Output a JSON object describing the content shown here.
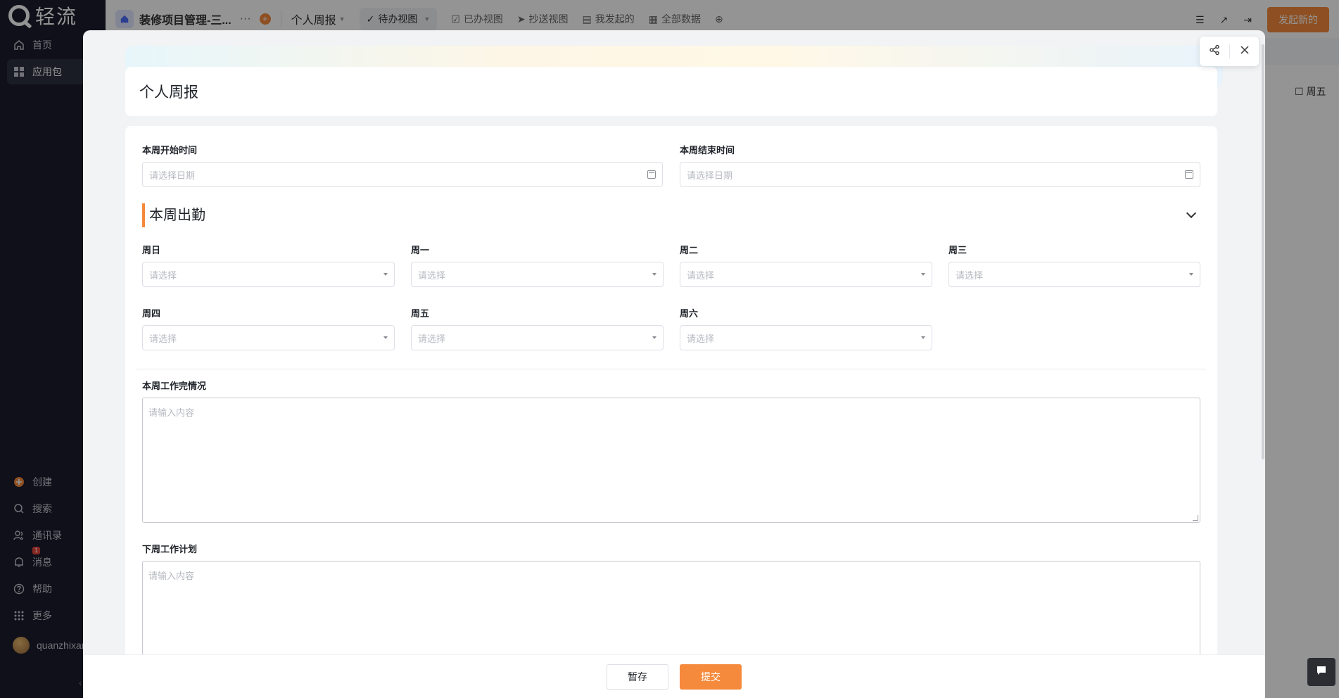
{
  "sidebar": {
    "logo_text": "轻流",
    "nav_top": [
      {
        "label": "首页",
        "icon": "home-icon"
      },
      {
        "label": "应用包",
        "icon": "apps-icon"
      }
    ],
    "nav_bottom": [
      {
        "label": "创建",
        "icon": "create-icon"
      },
      {
        "label": "搜索",
        "icon": "search-icon"
      },
      {
        "label": "通讯录",
        "icon": "contacts-icon"
      },
      {
        "label": "消息",
        "icon": "bell-icon",
        "badge": "1"
      },
      {
        "label": "帮助",
        "icon": "help-icon"
      },
      {
        "label": "更多",
        "icon": "grid-icon"
      },
      {
        "label": "quanzhixan",
        "icon": "avatar"
      }
    ]
  },
  "topbar": {
    "app_title": "装修项目管理-三...",
    "dots": "···",
    "view_name": "个人周报",
    "views": [
      "待办视图",
      "已办视图",
      "抄送视图",
      "我发起的",
      "全部数据"
    ],
    "start_button": "发起新的",
    "bg_column": "周五"
  },
  "form": {
    "title": "个人周报",
    "start_date": {
      "label": "本周开始时间",
      "placeholder": "请选择日期"
    },
    "end_date": {
      "label": "本周结束时间",
      "placeholder": "请选择日期"
    },
    "attendance_section": "本周出勤",
    "days": [
      {
        "label": "周日",
        "placeholder": "请选择"
      },
      {
        "label": "周一",
        "placeholder": "请选择"
      },
      {
        "label": "周二",
        "placeholder": "请选择"
      },
      {
        "label": "周三",
        "placeholder": "请选择"
      },
      {
        "label": "周四",
        "placeholder": "请选择"
      },
      {
        "label": "周五",
        "placeholder": "请选择"
      },
      {
        "label": "周六",
        "placeholder": "请选择"
      }
    ],
    "work_done": {
      "label": "本周工作完情况",
      "placeholder": "请输入内容"
    },
    "next_plan": {
      "label": "下周工作计划",
      "placeholder": "请输入内容"
    }
  },
  "footer": {
    "save_label": "暂存",
    "submit_label": "提交"
  },
  "colors": {
    "accent": "#f58a3c",
    "sidebar_bg": "#1b1d2b"
  }
}
